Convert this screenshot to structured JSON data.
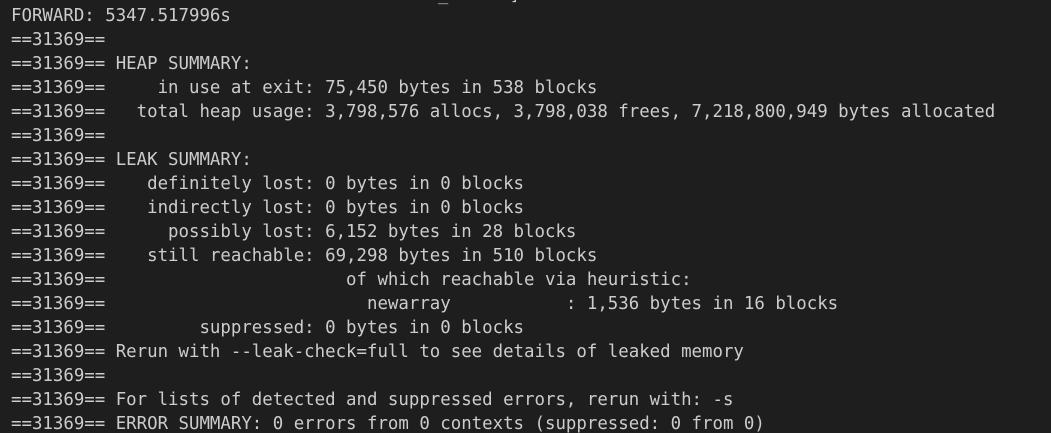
{
  "terminal": {
    "clipped_text": "_      ]",
    "lines": [
      "FORWARD: 5347.517996s",
      "==31369==",
      "==31369== HEAP SUMMARY:",
      "==31369==     in use at exit: 75,450 bytes in 538 blocks",
      "==31369==   total heap usage: 3,798,576 allocs, 3,798,038 frees, 7,218,800,949 bytes allocated",
      "==31369==",
      "==31369== LEAK SUMMARY:",
      "==31369==    definitely lost: 0 bytes in 0 blocks",
      "==31369==    indirectly lost: 0 bytes in 0 blocks",
      "==31369==      possibly lost: 6,152 bytes in 28 blocks",
      "==31369==    still reachable: 69,298 bytes in 510 blocks",
      "==31369==                       of which reachable via heuristic:",
      "==31369==                         newarray           : 1,536 bytes in 16 blocks",
      "==31369==         suppressed: 0 bytes in 0 blocks",
      "==31369== Rerun with --leak-check=full to see details of leaked memory",
      "==31369==",
      "==31369== For lists of detected and suppressed errors, rerun with: -s",
      "==31369== ERROR SUMMARY: 0 errors from 0 contexts (suppressed: 0 from 0)"
    ],
    "colors": {
      "background": "#1e1e1e",
      "text": "#cccccc"
    }
  }
}
